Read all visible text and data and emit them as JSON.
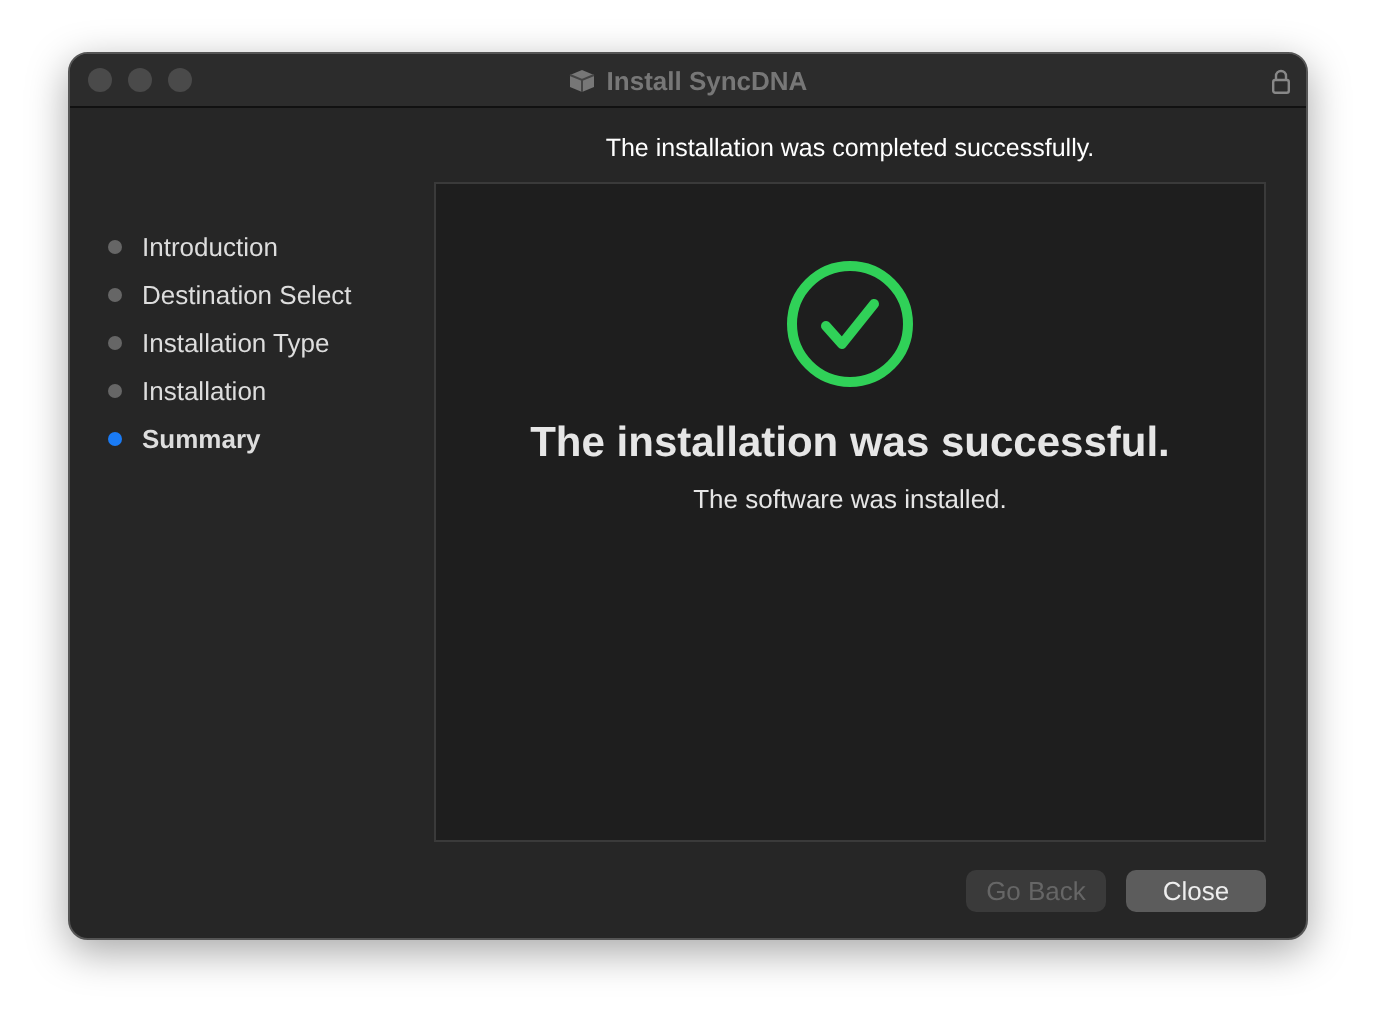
{
  "window": {
    "title": "Install SyncDNA"
  },
  "heading": "The installation was completed successfully.",
  "steps": [
    {
      "label": "Introduction",
      "selected": false
    },
    {
      "label": "Destination Select",
      "selected": false
    },
    {
      "label": "Installation Type",
      "selected": false
    },
    {
      "label": "Installation",
      "selected": false
    },
    {
      "label": "Summary",
      "selected": true
    }
  ],
  "result": {
    "title": "The installation was successful.",
    "message": "The software was installed."
  },
  "buttons": [
    {
      "label": "Go Back",
      "disabled": true
    },
    {
      "label": "Close",
      "disabled": false
    }
  ]
}
